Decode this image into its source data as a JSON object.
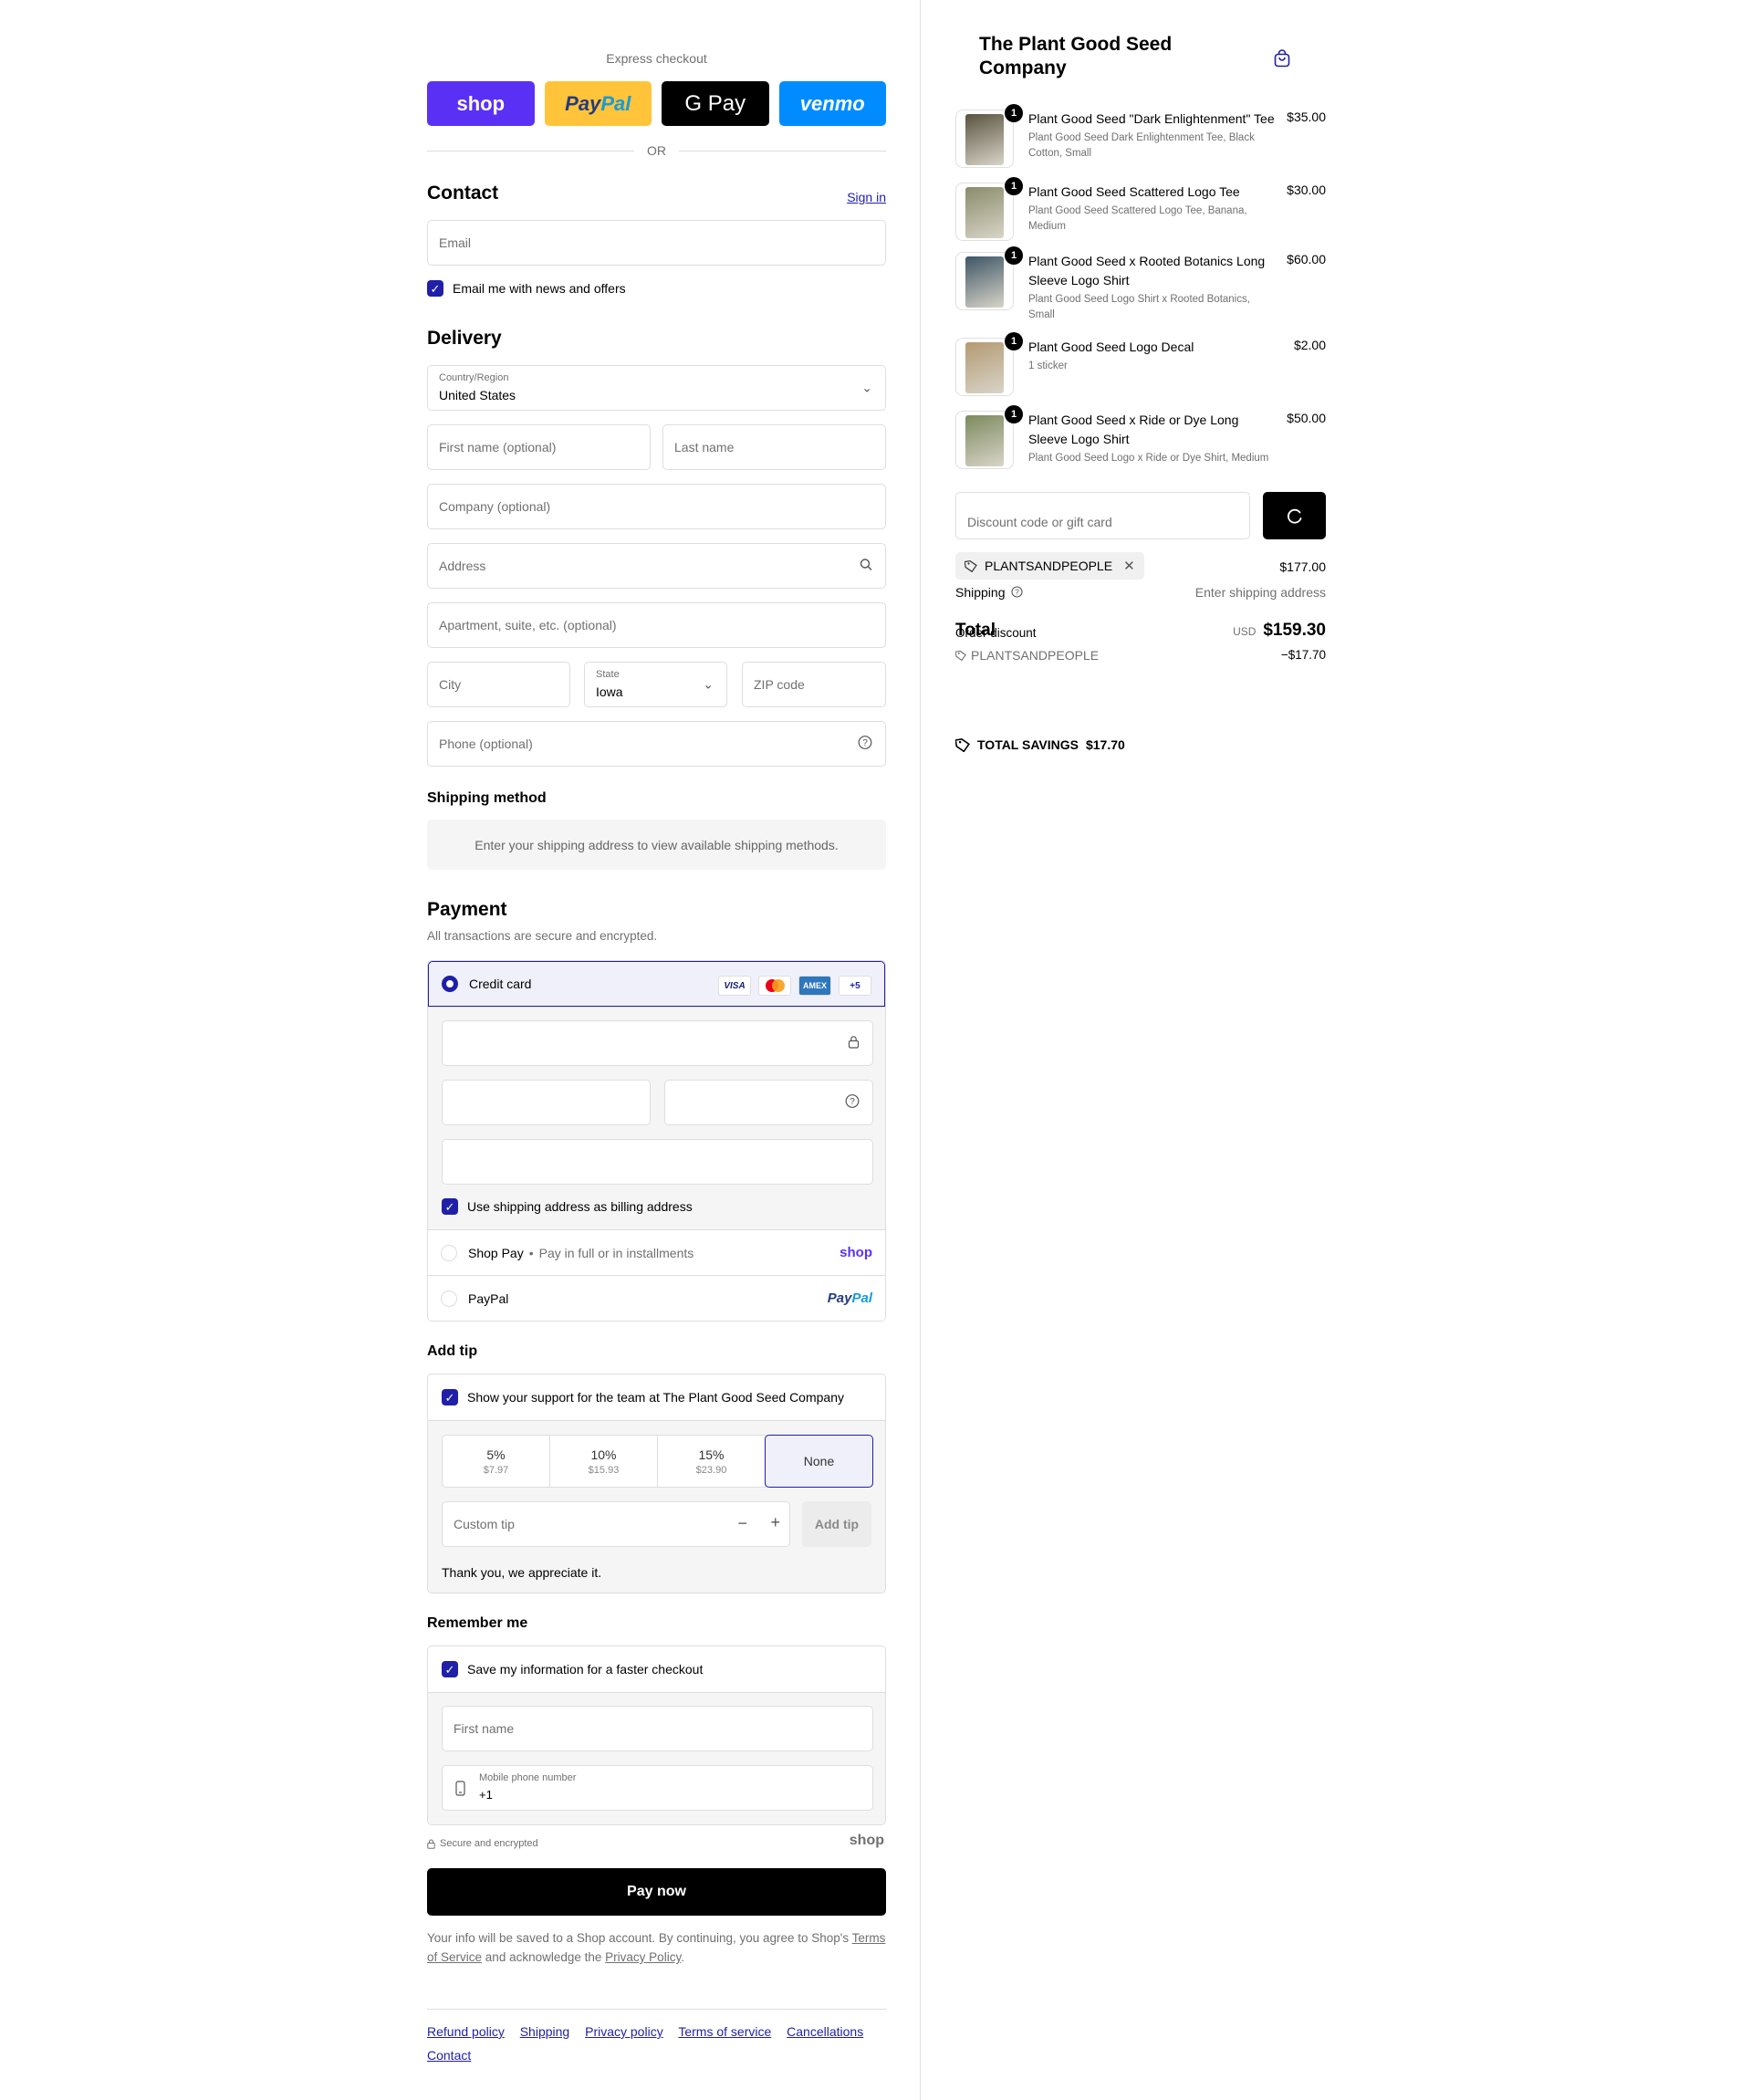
{
  "express": {
    "title": "Express checkout",
    "shop": "shop",
    "paypal_a": "Pay",
    "paypal_b": "Pal",
    "gpay": "G Pay",
    "venmo": "venmo",
    "or": "OR"
  },
  "contact": {
    "heading": "Contact",
    "sign_in": "Sign in",
    "email_placeholder": "Email",
    "newsletter": "Email me with news and offers"
  },
  "delivery": {
    "heading": "Delivery",
    "country_label": "Country/Region",
    "country_value": "United States",
    "first_name": "First name (optional)",
    "last_name": "Last name",
    "company": "Company (optional)",
    "address": "Address",
    "apartment": "Apartment, suite, etc. (optional)",
    "city": "City",
    "state_label": "State",
    "state_value": "Iowa",
    "zip": "ZIP code",
    "phone": "Phone (optional)"
  },
  "shipping_method": {
    "heading": "Shipping method",
    "message": "Enter your shipping address to view available shipping methods."
  },
  "payment": {
    "heading": "Payment",
    "subtitle": "All transactions are secure and encrypted.",
    "credit_card": "Credit card",
    "card_icons": [
      "VISA",
      "",
      "AMEX",
      "+5"
    ],
    "billing_same": "Use shipping address as billing address",
    "shop_pay": "Shop Pay",
    "shop_pay_sub": "Pay in full or in installments",
    "shop_pay_logo": "shop",
    "paypal": "PayPal",
    "paypal_logo_a": "Pay",
    "paypal_logo_b": "Pal"
  },
  "tip": {
    "heading": "Add tip",
    "support": "Show your support for the team at The Plant Good Seed Company",
    "options": [
      {
        "pct": "5%",
        "amt": "$7.97"
      },
      {
        "pct": "10%",
        "amt": "$15.93"
      },
      {
        "pct": "15%",
        "amt": "$23.90"
      },
      {
        "pct": "None",
        "amt": ""
      }
    ],
    "custom_placeholder": "Custom tip",
    "add_button": "Add tip",
    "thanks": "Thank you, we appreciate it."
  },
  "remember": {
    "heading": "Remember me",
    "save": "Save my information for a faster checkout",
    "first_name": "First name",
    "mobile_label": "Mobile phone number",
    "mobile_value": "+1",
    "secure": "Secure and encrypted",
    "shop_logo": "shop"
  },
  "pay_now": "Pay now",
  "legal": {
    "text1": "Your info will be saved to a Shop account. By continuing, you agree to Shop's",
    "terms": "Terms of Service",
    "text2": "and acknowledge the",
    "privacy": "Privacy Policy",
    "end": "."
  },
  "footer": {
    "links": [
      "Refund policy",
      "Shipping",
      "Privacy policy",
      "Terms of service",
      "Cancellations",
      "Contact"
    ]
  },
  "summary": {
    "store": "The Plant Good Seed Company",
    "items": [
      {
        "qty": "1",
        "name": "Plant Good Seed \"Dark Enlightenment\" Tee",
        "desc": "Plant Good Seed Dark Enlightenment Tee, Black Cotton, Small",
        "price": "$35.00",
        "color": "#5a5340"
      },
      {
        "qty": "1",
        "name": "Plant Good Seed Scattered Logo Tee",
        "desc": "Plant Good Seed Scattered Logo Tee, Banana, Medium",
        "price": "$30.00",
        "color": "#8a8c6a"
      },
      {
        "qty": "1",
        "name": "Plant Good Seed x Rooted Botanics Long Sleeve Logo Shirt",
        "desc": "Plant Good Seed Logo Shirt x Rooted Botanics, Small",
        "price": "$60.00",
        "color": "#3d5566"
      },
      {
        "qty": "1",
        "name": "Plant Good Seed Logo Decal",
        "desc": "1 sticker",
        "price": "$2.00",
        "color": "#b49a72"
      },
      {
        "qty": "1",
        "name": "Plant Good Seed x Ride or Dye Long Sleeve Logo Shirt",
        "desc": "Plant Good Seed Logo x Ride or Dye Shirt, Medium",
        "price": "$50.00",
        "color": "#7c8a5e"
      }
    ],
    "discount_placeholder": "Discount code or gift card",
    "applied_code": "PLANTSANDPEOPLE",
    "subtotal_value": "$177.00",
    "shipping_label": "Shipping",
    "shipping_value": "Enter shipping address",
    "total_label": "Total",
    "order_discount_label": "Order discount",
    "discount_code": "PLANTSANDPEOPLE",
    "discount_value": "−$17.70",
    "currency": "USD",
    "total_value": "$159.30",
    "savings_label": "TOTAL SAVINGS",
    "savings_value": "$17.70"
  },
  "colors": {
    "accent": "#1f1fa8",
    "shop_purple": "#5a31f4",
    "paypal_yellow": "#ffc439",
    "venmo_blue": "#008cff"
  }
}
